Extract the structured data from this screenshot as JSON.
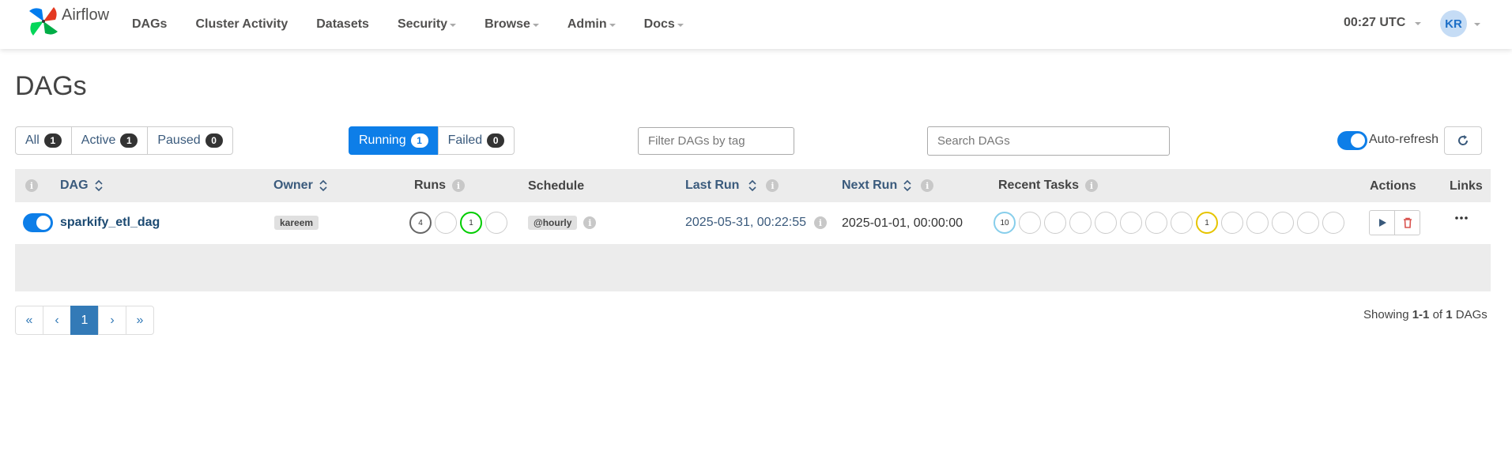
{
  "brand": {
    "name": "Airflow"
  },
  "nav": {
    "items": [
      {
        "label": "DAGs",
        "dropdown": false
      },
      {
        "label": "Cluster Activity",
        "dropdown": false
      },
      {
        "label": "Datasets",
        "dropdown": false
      },
      {
        "label": "Security",
        "dropdown": true
      },
      {
        "label": "Browse",
        "dropdown": true
      },
      {
        "label": "Admin",
        "dropdown": true
      },
      {
        "label": "Docs",
        "dropdown": true
      }
    ],
    "time": "00:27 UTC",
    "user_initials": "KR"
  },
  "page": {
    "title": "DAGs"
  },
  "filters": {
    "status": [
      {
        "label": "All",
        "count": "1"
      },
      {
        "label": "Active",
        "count": "1"
      },
      {
        "label": "Paused",
        "count": "0"
      }
    ],
    "run_state": [
      {
        "label": "Running",
        "count": "1",
        "active": true
      },
      {
        "label": "Failed",
        "count": "0",
        "active": false
      }
    ],
    "tag_placeholder": "Filter DAGs by tag",
    "search_placeholder": "Search DAGs",
    "auto_refresh_label": "Auto-refresh"
  },
  "table": {
    "headers": {
      "dag": "DAG",
      "owner": "Owner",
      "runs": "Runs",
      "schedule": "Schedule",
      "last_run": "Last Run",
      "next_run": "Next Run",
      "recent_tasks": "Recent Tasks",
      "actions": "Actions",
      "links": "Links"
    },
    "rows": [
      {
        "dag_id": "sparkify_etl_dag",
        "owner": "kareem",
        "runs": [
          {
            "count": "4",
            "color": "#666666"
          },
          {
            "count": "",
            "color": "#cccccc"
          },
          {
            "count": "1",
            "color": "#00cc00"
          },
          {
            "count": "",
            "color": "#cccccc"
          }
        ],
        "schedule": "@hourly",
        "last_run": "2025-05-31, 00:22:55",
        "next_run": "2025-01-01, 00:00:00",
        "recent_tasks": [
          {
            "count": "10",
            "color": "#87ceeb"
          },
          {
            "count": "",
            "color": "#cccccc"
          },
          {
            "count": "",
            "color": "#cccccc"
          },
          {
            "count": "",
            "color": "#cccccc"
          },
          {
            "count": "",
            "color": "#cccccc"
          },
          {
            "count": "",
            "color": "#cccccc"
          },
          {
            "count": "",
            "color": "#cccccc"
          },
          {
            "count": "",
            "color": "#cccccc"
          },
          {
            "count": "1",
            "color": "#e6c400"
          },
          {
            "count": "",
            "color": "#cccccc"
          },
          {
            "count": "",
            "color": "#cccccc"
          },
          {
            "count": "",
            "color": "#cccccc"
          },
          {
            "count": "",
            "color": "#cccccc"
          },
          {
            "count": "",
            "color": "#cccccc"
          }
        ]
      }
    ]
  },
  "pagination": {
    "first": "«",
    "prev": "‹",
    "current": "1",
    "next": "›",
    "last": "»"
  },
  "showing": {
    "prefix": "Showing",
    "range": "1-1",
    "of": "of",
    "total": "1",
    "suffix": "DAGs"
  },
  "colors": {
    "primary": "#0d7ee8",
    "link": "#3a5a7c",
    "danger": "#d9534f"
  }
}
